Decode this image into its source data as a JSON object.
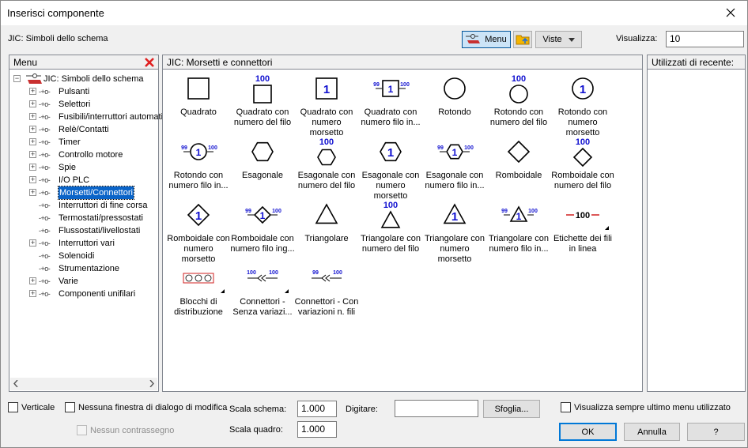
{
  "window": {
    "title": "Inserisci componente"
  },
  "toolbar": {
    "library_label": "JIC: Simboli dello schema",
    "menu_button": "Menu",
    "viste_button": "Viste",
    "visualizza_label": "Visualizza:",
    "visualizza_value": "10"
  },
  "menu_panel": {
    "header": "Menu",
    "tree": [
      {
        "label": "JIC: Simboli dello schema",
        "expandable": true,
        "root": true
      },
      {
        "label": "Pulsanti",
        "expandable": true
      },
      {
        "label": "Selettori",
        "expandable": true
      },
      {
        "label": "Fusibili/interruttori automatici",
        "expandable": true
      },
      {
        "label": "Relè/Contatti",
        "expandable": true
      },
      {
        "label": "Timer",
        "expandable": true
      },
      {
        "label": "Controllo motore",
        "expandable": true
      },
      {
        "label": "Spie",
        "expandable": true
      },
      {
        "label": "I/O PLC",
        "expandable": true
      },
      {
        "label": "Morsetti/Connettori",
        "expandable": true,
        "selected": true
      },
      {
        "label": "Interruttori di fine corsa",
        "expandable": false
      },
      {
        "label": "Termostati/pressostati",
        "expandable": false
      },
      {
        "label": "Flussostati/livellostati",
        "expandable": false
      },
      {
        "label": "Interruttori vari",
        "expandable": true
      },
      {
        "label": "Solenoidi",
        "expandable": false
      },
      {
        "label": "Strumentazione",
        "expandable": false
      },
      {
        "label": "Varie",
        "expandable": true
      },
      {
        "label": "Componenti unifilari",
        "expandable": true
      }
    ]
  },
  "symbols_panel": {
    "header": "JIC: Morsetti e connettori",
    "symbols": [
      {
        "name": "Quadrato",
        "icon": "square-icon",
        "wire": "",
        "num": ""
      },
      {
        "name": "Quadrato con numero del filo",
        "icon": "square-wire-number-icon",
        "wire": "100",
        "num": ""
      },
      {
        "name": "Quadrato con numero morsetto",
        "icon": "square-terminal-number-icon",
        "wire": "",
        "num": "1"
      },
      {
        "name": "Quadrato con numero filo in...",
        "icon": "square-inline-wire-icon",
        "wire": "100",
        "num": "1"
      },
      {
        "name": "Rotondo",
        "icon": "circle-icon",
        "wire": "",
        "num": ""
      },
      {
        "name": "Rotondo con numero del filo",
        "icon": "circle-wire-number-icon",
        "wire": "100",
        "num": ""
      },
      {
        "name": "Rotondo con numero morsetto",
        "icon": "circle-terminal-number-icon",
        "wire": "",
        "num": "1"
      },
      {
        "name": "Rotondo con numero filo in...",
        "icon": "circle-inline-wire-icon",
        "wire": "100",
        "num": "1"
      },
      {
        "name": "Esagonale",
        "icon": "hexagon-icon",
        "wire": "",
        "num": ""
      },
      {
        "name": "Esagonale con numero del filo",
        "icon": "hexagon-wire-number-icon",
        "wire": "100",
        "num": ""
      },
      {
        "name": "Esagonale con numero morsetto",
        "icon": "hexagon-terminal-number-icon",
        "wire": "",
        "num": "1"
      },
      {
        "name": "Esagonale con numero filo in...",
        "icon": "hexagon-inline-wire-icon",
        "wire": "100",
        "num": "1"
      },
      {
        "name": "Romboidale",
        "icon": "diamond-icon",
        "wire": "",
        "num": ""
      },
      {
        "name": "Romboidale con numero del filo",
        "icon": "diamond-wire-number-icon",
        "wire": "100",
        "num": ""
      },
      {
        "name": "Romboidale con numero morsetto",
        "icon": "diamond-terminal-number-icon",
        "wire": "",
        "num": "1"
      },
      {
        "name": "Romboidale con numero filo ing...",
        "icon": "diamond-inline-wire-icon",
        "wire": "100",
        "num": "1"
      },
      {
        "name": "Triangolare",
        "icon": "triangle-icon",
        "wire": "",
        "num": ""
      },
      {
        "name": "Triangolare con numero del filo",
        "icon": "triangle-wire-number-icon",
        "wire": "100",
        "num": ""
      },
      {
        "name": "Triangolare con numero morsetto",
        "icon": "triangle-terminal-number-icon",
        "wire": "",
        "num": "1"
      },
      {
        "name": "Triangolare con numero filo in...",
        "icon": "triangle-inline-wire-icon",
        "wire": "100",
        "num": "1"
      },
      {
        "name": "Etichette dei fili in linea",
        "icon": "inline-wire-label-icon",
        "wire": "100",
        "num": "",
        "has_submenu": true
      },
      {
        "name": "Blocchi di distribuzione",
        "icon": "distribution-block-icon",
        "wire": "",
        "num": "",
        "has_submenu": true
      },
      {
        "name": "Connettori - Senza variazi...",
        "icon": "connector-no-change-icon",
        "wire": "100",
        "num": "",
        "has_submenu": true
      },
      {
        "name": "Connettori - Con variazioni n. fili",
        "icon": "connector-wire-change-icon",
        "wire": "100",
        "num": ""
      }
    ]
  },
  "recent_panel": {
    "header": "Utilizzati di recente:"
  },
  "bottom": {
    "verticale": "Verticale",
    "nessuna_finestra": "Nessuna finestra di dialogo di modifica",
    "nessun_contrassegno": "Nessun contrassegno",
    "scala_schema_label": "Scala schema:",
    "scala_schema_value": "1.000",
    "scala_quadro_label": "Scala quadro:",
    "scala_quadro_value": "1.000",
    "digitare_label": "Digitare:",
    "digitare_value": "",
    "sfoglia": "Sfoglia...",
    "visualizza_sempre": "Visualizza sempre ultimo menu utilizzato",
    "ok": "OK",
    "annulla": "Annulla",
    "help": "?"
  },
  "colors": {
    "symbol_number": "#1010d0",
    "selection": "#0a64c8",
    "delete_x": "#e02020",
    "inline_label_line": "#d02020"
  }
}
